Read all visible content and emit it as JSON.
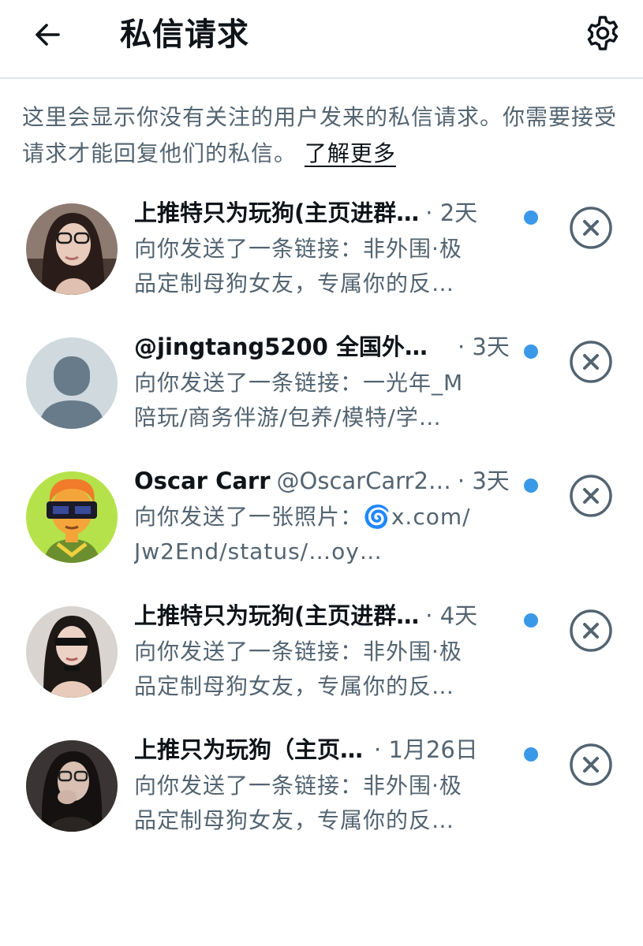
{
  "header": {
    "title": "私信请求",
    "back_icon": "arrow-left-icon",
    "settings_icon": "gear-icon"
  },
  "intro": {
    "text": "这里会显示你没有关注的用户发来的私信请求。你需要接受请求才能回复他们的私信。",
    "learn_more": "了解更多"
  },
  "colors": {
    "text_primary": "#0f1419",
    "text_secondary": "#536471",
    "unread_dot": "#3a98e8",
    "divider": "#dfe6ea"
  },
  "requests": [
    {
      "name": "上推特只为玩狗(主页进群…",
      "handle": "",
      "time": "· 2天",
      "message_line1": "向你发送了一条链接：非外围·极",
      "message_line2": "品定制母狗女友，专属你的反…",
      "avatar": "photo-avatar",
      "unread": true
    },
    {
      "name": "@jingtang5200 全国外…",
      "handle": "",
      "time": "· 3天",
      "message_line1": "向你发送了一条链接：一光年_M",
      "message_line2": "陪玩/商务伴游/包养/模特/学…",
      "avatar": "default-avatar",
      "unread": true
    },
    {
      "name": "Oscar Carr",
      "handle": "@OscarCarr2…",
      "time": "· 3天",
      "message_line1": "向你发送了一张照片：🌀x.com/",
      "message_line2": "Jw2End/status/…oy…",
      "avatar": "cartoon-avatar",
      "unread": true
    },
    {
      "name": "上推特只为玩狗(主页进群…",
      "handle": "",
      "time": "· 4天",
      "message_line1": "向你发送了一条链接：非外围·极",
      "message_line2": "品定制母狗女友，专属你的反…",
      "avatar": "photo-avatar",
      "unread": true
    },
    {
      "name": "上推只为玩狗（主页…",
      "handle": "",
      "time": "· 1月26日",
      "message_line1": "向你发送了一条链接：非外围·极",
      "message_line2": "品定制母狗女友，专属你的反…",
      "avatar": "photo-avatar",
      "unread": true
    }
  ]
}
